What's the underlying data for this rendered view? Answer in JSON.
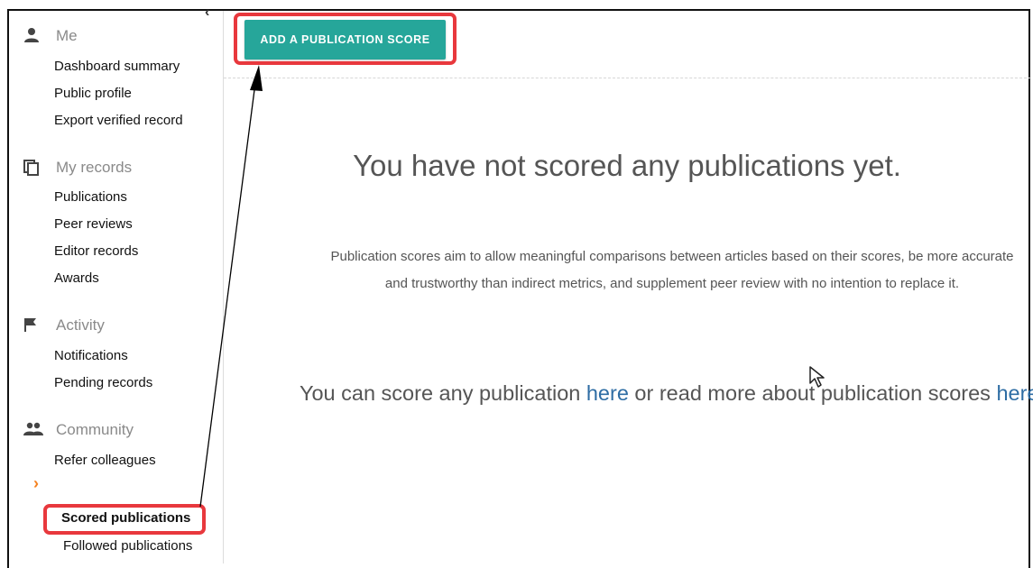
{
  "sidebar": {
    "sections": [
      {
        "icon": "person-icon",
        "label": "Me",
        "items": [
          "Dashboard summary",
          "Public profile",
          "Export verified record"
        ]
      },
      {
        "icon": "copy-icon",
        "label": "My records",
        "items": [
          "Publications",
          "Peer reviews",
          "Editor records",
          "Awards"
        ]
      },
      {
        "icon": "flag-icon",
        "label": "Activity",
        "items": [
          "Notifications",
          "Pending records"
        ]
      },
      {
        "icon": "group-icon",
        "label": "Community",
        "items": [
          "Refer colleagues"
        ]
      }
    ],
    "collapse_icon": "chevron-left-icon",
    "expand_icon": "chevron-right-icon",
    "active_item": "Scored publications",
    "next_item": "Followed publications"
  },
  "toolbar": {
    "add_label": "ADD A PUBLICATION SCORE"
  },
  "empty_state": {
    "title": "You have not scored any publications yet.",
    "description": "Publication scores aim to allow meaningful comparisons between articles based on their scores, be more accurate and trustworthy than indirect metrics, and supplement peer review with no intention to replace it.",
    "cta_part1": "You can score any publication ",
    "cta_link1": "here",
    "cta_part2": " or read more about publication scores ",
    "cta_link2": "here",
    "cta_end": "."
  },
  "colors": {
    "accent": "#26a69a",
    "highlight": "#e8383d",
    "link": "#2e6da4",
    "chevron": "#f58220"
  }
}
